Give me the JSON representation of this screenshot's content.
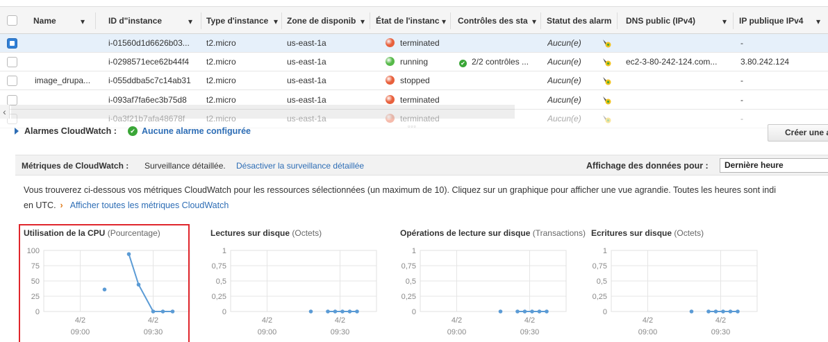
{
  "table": {
    "columns": [
      {
        "label": "Name"
      },
      {
        "label": "ID d\"instance"
      },
      {
        "label": "Type d'instance"
      },
      {
        "label": "Zone de disponib"
      },
      {
        "label": "État de l'instanc"
      },
      {
        "label": "Contrôles des sta"
      },
      {
        "label": "Statut des alarm"
      },
      {
        "label": "DNS public (IPv4)"
      },
      {
        "label": "IP publique IPv4"
      }
    ],
    "rows": [
      {
        "name": "",
        "id": "i-01560d1d6626b03...",
        "type": "t2.micro",
        "zone": "us-east-1a",
        "state": "terminated",
        "state_color": "#e8603c",
        "checks": "",
        "alarm": "Aucun(e)",
        "dns": "",
        "ip": "-",
        "selected": true
      },
      {
        "name": "",
        "id": "i-0298571ece62b44f4",
        "type": "t2.micro",
        "zone": "us-east-1a",
        "state": "running",
        "state_color": "#56b949",
        "checks": "2/2 contrôles ...",
        "alarm": "Aucun(e)",
        "dns": "ec2-3-80-242-124.com...",
        "ip": "3.80.242.124",
        "selected": false
      },
      {
        "name": "image_drupa...",
        "id": "i-055ddba5c7c14ab31",
        "type": "t2.micro",
        "zone": "us-east-1a",
        "state": "stopped",
        "state_color": "#e8603c",
        "checks": "",
        "alarm": "Aucun(e)",
        "dns": "",
        "ip": "-",
        "selected": false
      },
      {
        "name": "",
        "id": "i-093af7fa6ec3b75d8",
        "type": "t2.micro",
        "zone": "us-east-1a",
        "state": "terminated",
        "state_color": "#e8603c",
        "checks": "",
        "alarm": "Aucun(e)",
        "dns": "",
        "ip": "-",
        "selected": false
      },
      {
        "name": "",
        "id": "i-0a3f21b7afa48678f",
        "type": "t2.micro",
        "zone": "us-east-1a",
        "state": "terminated",
        "state_color": "#e8603c",
        "checks": "",
        "alarm": "Aucun(e)",
        "dns": "",
        "ip": "-",
        "selected": false
      }
    ]
  },
  "alarms": {
    "label": "Alarmes CloudWatch :",
    "link": "Aucune alarme configurée",
    "create_button": "Créer une a"
  },
  "metrics": {
    "title": "Métriques de CloudWatch :",
    "description": "Surveillance détaillée.",
    "toggle_link": "Désactiver la surveillance détaillée",
    "display_label": "Affichage des données pour :",
    "display_value": "Dernière heure",
    "info_text": "Vous trouverez ci-dessous vos métriques CloudWatch pour les ressources sélectionnées (un maximum de 10). Cliquez sur un graphique pour afficher une vue agrandie. Toutes les heures sont indi",
    "info_text_2": "en UTC.",
    "all_metrics_link": "Afficher toutes les métriques CloudWatch"
  },
  "chart_data": [
    {
      "type": "line",
      "title": "Utilisation de la CPU",
      "unit": "(Pourcentage)",
      "yticks": [
        "100",
        "75",
        "50",
        "25",
        "0"
      ],
      "ylim": [
        0,
        100
      ],
      "xticks": [
        {
          "day": "4/2",
          "time": "09:00"
        },
        {
          "day": "4/2",
          "time": "09:30"
        }
      ],
      "xlim": [
        "08:45",
        "09:45"
      ],
      "isolated_points": [
        {
          "x": "09:10",
          "y": 36
        }
      ],
      "line": [
        {
          "x": "09:20",
          "y": 94
        },
        {
          "x": "09:24",
          "y": 44
        },
        {
          "x": "09:30",
          "y": 0
        },
        {
          "x": "09:34",
          "y": 0
        },
        {
          "x": "09:38",
          "y": 0
        }
      ],
      "color": "#5b9bd5"
    },
    {
      "type": "line",
      "title": "Lectures sur disque",
      "unit": "(Octets)",
      "yticks": [
        "1",
        "0,75",
        "0,5",
        "0,25",
        "0"
      ],
      "ylim": [
        0,
        1
      ],
      "xticks": [
        {
          "day": "4/2",
          "time": "09:00"
        },
        {
          "day": "4/2",
          "time": "09:30"
        }
      ],
      "xlim": [
        "08:45",
        "09:45"
      ],
      "isolated_points": [
        {
          "x": "09:18",
          "y": 0
        }
      ],
      "line": [
        {
          "x": "09:25",
          "y": 0
        },
        {
          "x": "09:28",
          "y": 0
        },
        {
          "x": "09:31",
          "y": 0
        },
        {
          "x": "09:34",
          "y": 0
        },
        {
          "x": "09:37",
          "y": 0
        }
      ],
      "color": "#5b9bd5"
    },
    {
      "type": "line",
      "title": "Opérations de lecture sur disque",
      "unit": "(Transactions)",
      "yticks": [
        "1",
        "0,75",
        "0,5",
        "0,25",
        "0"
      ],
      "ylim": [
        0,
        1
      ],
      "xticks": [
        {
          "day": "4/2",
          "time": "09:00"
        },
        {
          "day": "4/2",
          "time": "09:30"
        }
      ],
      "xlim": [
        "08:45",
        "09:45"
      ],
      "isolated_points": [
        {
          "x": "09:18",
          "y": 0
        }
      ],
      "line": [
        {
          "x": "09:25",
          "y": 0
        },
        {
          "x": "09:28",
          "y": 0
        },
        {
          "x": "09:31",
          "y": 0
        },
        {
          "x": "09:34",
          "y": 0
        },
        {
          "x": "09:37",
          "y": 0
        }
      ],
      "color": "#5b9bd5"
    },
    {
      "type": "line",
      "title": "Ecritures sur disque",
      "unit": "(Octets)",
      "yticks": [
        "1",
        "0,75",
        "0,5",
        "0,25",
        "0"
      ],
      "ylim": [
        0,
        1
      ],
      "xticks": [
        {
          "day": "4/2",
          "time": "09:00"
        },
        {
          "day": "4/2",
          "time": "09:30"
        }
      ],
      "xlim": [
        "08:45",
        "09:45"
      ],
      "isolated_points": [
        {
          "x": "09:18",
          "y": 0
        }
      ],
      "line": [
        {
          "x": "09:25",
          "y": 0
        },
        {
          "x": "09:28",
          "y": 0
        },
        {
          "x": "09:31",
          "y": 0
        },
        {
          "x": "09:34",
          "y": 0
        },
        {
          "x": "09:37",
          "y": 0
        }
      ],
      "color": "#5b9bd5"
    }
  ]
}
